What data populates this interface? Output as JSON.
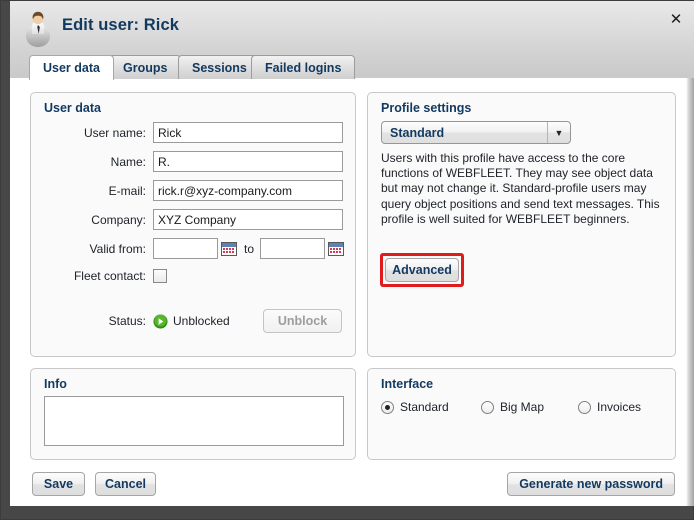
{
  "window": {
    "title": "Edit user: Rick",
    "avatar_icon": "user-avatar-icon",
    "close_icon": "✕"
  },
  "tabs": [
    {
      "label": "User data",
      "active": true
    },
    {
      "label": "Groups",
      "active": false
    },
    {
      "label": "Sessions",
      "active": false
    },
    {
      "label": "Failed logins",
      "active": false
    }
  ],
  "user_data": {
    "panel_title": "User data",
    "fields": [
      {
        "label": "User name:",
        "value": "Rick"
      },
      {
        "label": "Name:",
        "value": "R."
      },
      {
        "label": "E-mail:",
        "value": "rick.r@xyz-company.com"
      },
      {
        "label": "Company:",
        "value": "XYZ Company"
      }
    ],
    "valid_from": {
      "label": "Valid from:",
      "from_value": "",
      "to_label": "to",
      "to_value": "",
      "calendar_icon": "calendar-icon"
    },
    "fleet_contact": {
      "label": "Fleet contact:",
      "checked": false
    },
    "status": {
      "label": "Status:",
      "value": "Unblocked",
      "icon": "green-play-icon",
      "icon_color": "#3ca016",
      "button_label": "Unblock",
      "button_disabled": true
    }
  },
  "profile_settings": {
    "panel_title": "Profile settings",
    "selected_profile": "Standard",
    "dropdown_arrow_icon": "▼",
    "description": "Users with this profile have access to the core functions of WEBFLEET. They may see object data but may not change it. Standard-profile users may query object positions and send text messages. This profile is well suited for WEBFLEET beginners.",
    "advanced_button": "Advanced",
    "highlight_color": "#e01b1b"
  },
  "info": {
    "panel_title": "Info",
    "value": "",
    "placeholder": ""
  },
  "interface": {
    "panel_title": "Interface",
    "options": [
      {
        "label": "Standard",
        "selected": true
      },
      {
        "label": "Big Map",
        "selected": false
      },
      {
        "label": "Invoices",
        "selected": false
      }
    ]
  },
  "footer": {
    "save_label": "Save",
    "cancel_label": "Cancel",
    "generate_password_label": "Generate new password"
  }
}
